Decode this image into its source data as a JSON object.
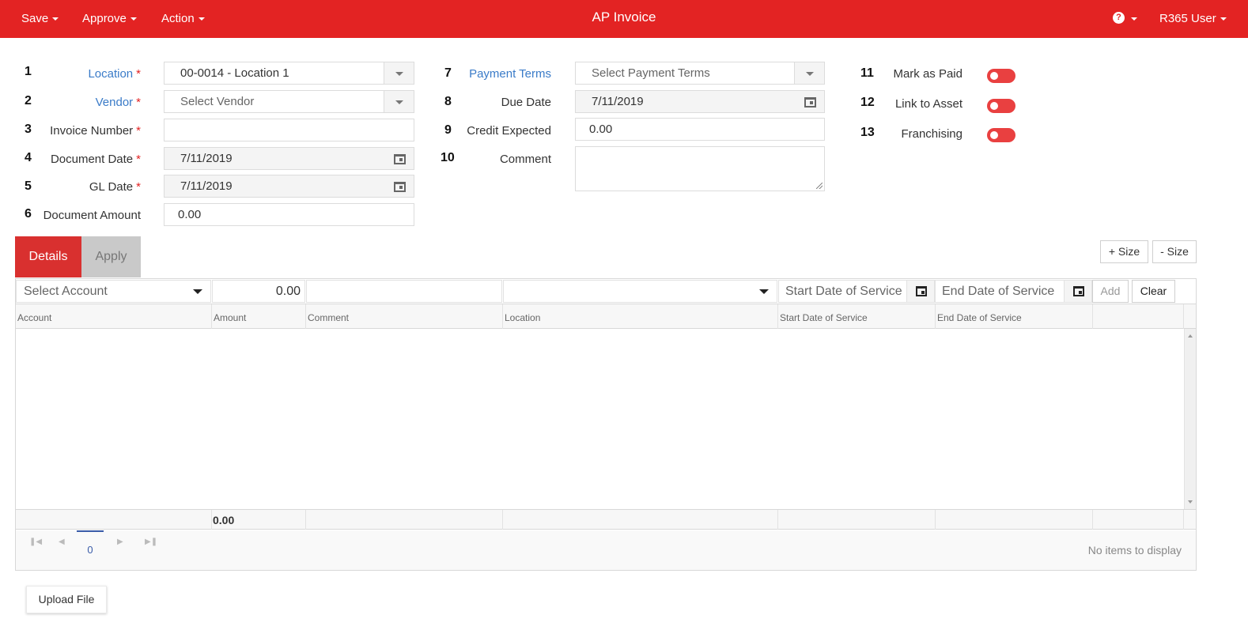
{
  "topbar": {
    "title": "AP Invoice",
    "menus": [
      "Save",
      "Approve",
      "Action"
    ],
    "help_icon": "question-circle-icon",
    "user": "R365 User"
  },
  "form": {
    "fields": [
      {
        "num": "1",
        "label": "Location",
        "required": "*",
        "value": "00-0014 - Location 1"
      },
      {
        "num": "2",
        "label": "Vendor",
        "required": "*",
        "placeholder": "Select Vendor"
      },
      {
        "num": "3",
        "label": "Invoice Number",
        "required": "*",
        "value": ""
      },
      {
        "num": "4",
        "label": "Document Date",
        "required": "*",
        "value": "7/11/2019"
      },
      {
        "num": "5",
        "label": "GL Date",
        "required": "*",
        "value": "7/11/2019"
      },
      {
        "num": "6",
        "label": "Document Amount",
        "value": "0.00"
      },
      {
        "num": "7",
        "label": "Payment Terms",
        "placeholder": "Select Payment Terms"
      },
      {
        "num": "8",
        "label": "Due Date",
        "value": "7/11/2019"
      },
      {
        "num": "9",
        "label": "Credit Expected",
        "value": "0.00"
      },
      {
        "num": "10",
        "label": "Comment",
        "value": ""
      }
    ],
    "toggles": [
      {
        "num": "11",
        "label": "Mark as Paid",
        "state": "off"
      },
      {
        "num": "12",
        "label": "Link to Asset",
        "state": "off"
      },
      {
        "num": "13",
        "label": "Franchising",
        "state": "off"
      }
    ]
  },
  "tabs": {
    "details": "Details",
    "apply": "Apply"
  },
  "size_buttons": {
    "plus": "+ Size",
    "minus": "- Size"
  },
  "entry": {
    "account_placeholder": "Select Account",
    "amount": "0.00",
    "start_placeholder": "Start Date of Service",
    "end_placeholder": "End Date of Service",
    "add": "Add",
    "clear": "Clear"
  },
  "grid": {
    "columns": [
      "Account",
      "Amount",
      "Comment",
      "Location",
      "Start Date of Service",
      "End Date of Service"
    ],
    "rows": [],
    "total_amount": "0.00"
  },
  "pager": {
    "page": "0",
    "status": "No items to display"
  },
  "upload_label": "Upload File",
  "colors": {
    "brand": "#e32323",
    "active_tab": "#d9302f",
    "toggle": "#e94040",
    "link": "#3a7bc8"
  }
}
